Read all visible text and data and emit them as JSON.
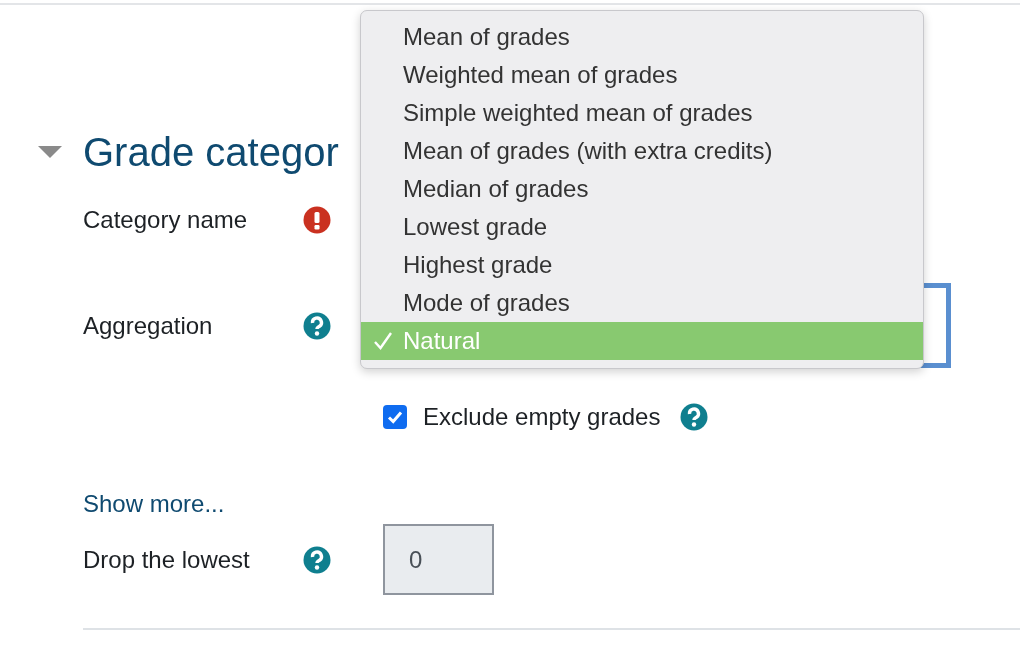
{
  "section": {
    "title": "Grade categor",
    "expanded": true
  },
  "category_name": {
    "label": "Category name",
    "required": true
  },
  "aggregation": {
    "label": "Aggregation",
    "help": true,
    "focused": true
  },
  "exclude_empty": {
    "label": "Exclude empty grades",
    "checked": true,
    "help": true
  },
  "show_more": {
    "label": "Show more..."
  },
  "drop_lowest": {
    "label": "Drop the lowest",
    "help": true,
    "value": "0",
    "disabled": true
  },
  "dropdown": {
    "options": [
      {
        "label": "Mean of grades",
        "selected": false
      },
      {
        "label": "Weighted mean of grades",
        "selected": false
      },
      {
        "label": "Simple weighted mean of grades",
        "selected": false
      },
      {
        "label": "Mean of grades (with extra credits)",
        "selected": false
      },
      {
        "label": "Median of grades",
        "selected": false
      },
      {
        "label": "Lowest grade",
        "selected": false
      },
      {
        "label": "Highest grade",
        "selected": false
      },
      {
        "label": "Mode of grades",
        "selected": false
      },
      {
        "label": "Natural",
        "selected": true
      }
    ]
  }
}
